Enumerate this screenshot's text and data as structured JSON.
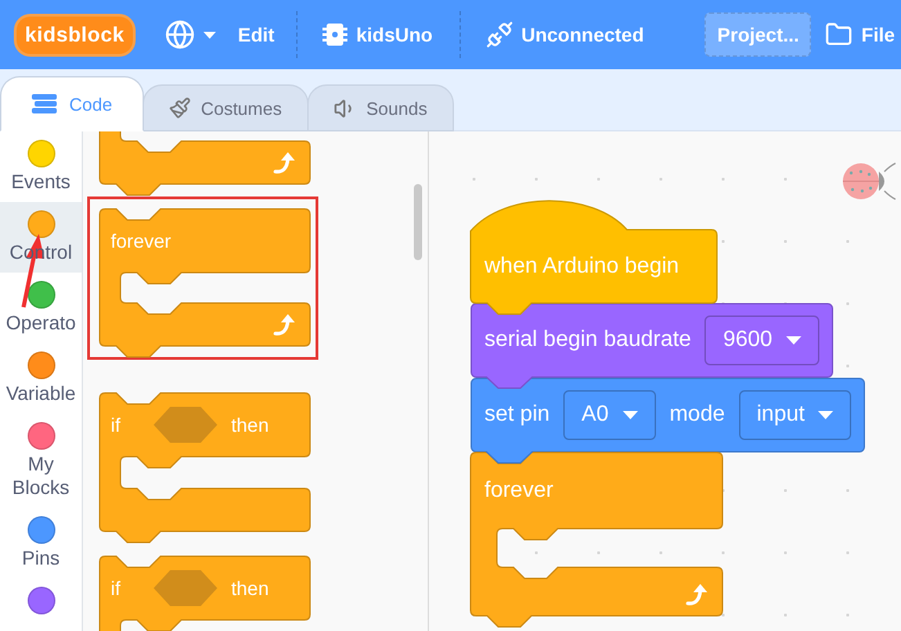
{
  "menu_bar": {
    "logo": "kidsblock",
    "edit": "Edit",
    "board": "kidsUno",
    "connection": "Unconnected",
    "project": "Project...",
    "file": "File"
  },
  "tabs": [
    {
      "kind": "code",
      "label": "Code",
      "selected": true
    },
    {
      "kind": "costumes",
      "label": "Costumes",
      "selected": false
    },
    {
      "kind": "sounds",
      "label": "Sounds",
      "selected": false
    }
  ],
  "categories": [
    {
      "label": "Events",
      "color": "#ffd500",
      "selected": false
    },
    {
      "label": "Control",
      "color": "#ffab19",
      "selected": true
    },
    {
      "label": "Operato",
      "color": "#40bf4a",
      "selected": false
    },
    {
      "label": "Variable",
      "color": "#ff8c1a",
      "selected": false
    },
    {
      "label": "My Blocks",
      "color": "#ff6680",
      "selected": false
    },
    {
      "label": "Pins",
      "color": "#4c97ff",
      "selected": false
    },
    {
      "color": "#9966ff",
      "selected": false
    }
  ],
  "palette": [
    {
      "kind": "c_block",
      "loop": true,
      "highlighted": false
    },
    {
      "kind": "c_block",
      "label": "forever",
      "loop": true,
      "highlighted": true
    },
    {
      "kind": "if_block",
      "label": "if",
      "label_2": "then",
      "loop": false,
      "highlighted": false
    },
    {
      "kind": "if_block",
      "label": "if",
      "label_2": "then",
      "loop": false,
      "highlighted": false
    }
  ],
  "script": [
    {
      "kind": "hat",
      "label": "when Arduino begin",
      "color": "#ffbf00"
    },
    {
      "kind": "stack",
      "color": "#9966ff",
      "parts": [
        {
          "kind": "text",
          "text": "serial begin baudrate"
        },
        {
          "kind": "dropdown",
          "text": "9600"
        }
      ]
    },
    {
      "kind": "stack",
      "color": "#4c97ff",
      "parts": [
        {
          "kind": "text",
          "text": "set pin"
        },
        {
          "kind": "dropdown",
          "text": "A0"
        },
        {
          "kind": "text",
          "text": "mode"
        },
        {
          "kind": "dropdown",
          "text": "input"
        }
      ]
    },
    {
      "kind": "c_block",
      "label": "forever",
      "color": "#ffab19",
      "loop": true
    }
  ]
}
